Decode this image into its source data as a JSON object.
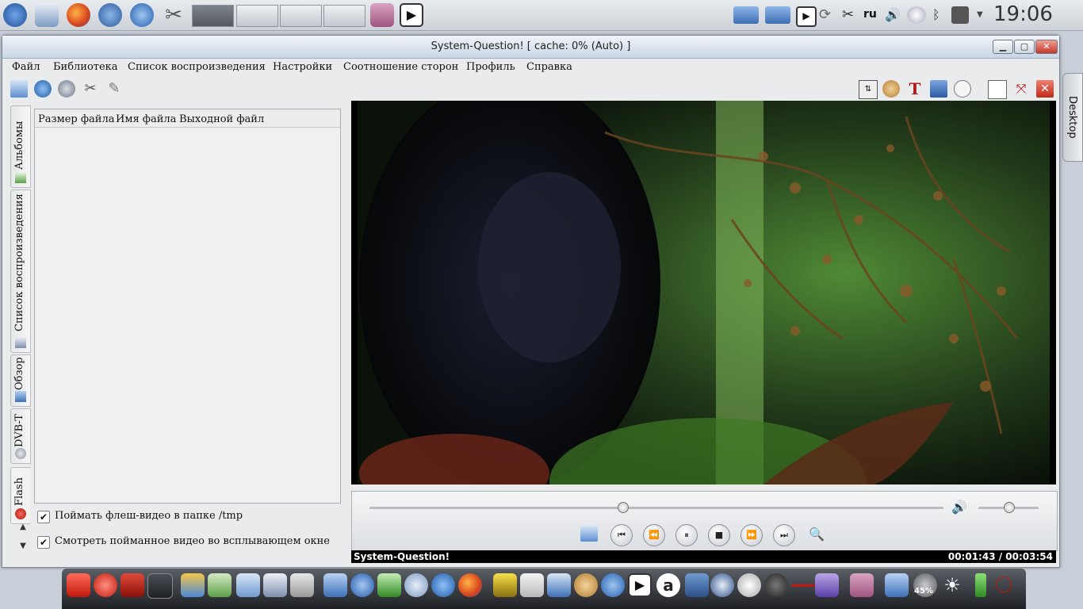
{
  "topbar": {
    "language": "ru",
    "clock": "19:06",
    "launchers": [
      "kde-menu-icon",
      "files-icon",
      "firefox-icon",
      "thunderbird-icon",
      "browser-icon",
      "settings-tools-icon"
    ],
    "taskbar_tabs": 4
  },
  "window": {
    "title": "System-Question! [ cache: 0% (Auto) ]",
    "controls": [
      "minimize",
      "maximize",
      "close"
    ]
  },
  "menu": [
    "Файл",
    "Библиотека",
    "Список воспроизведения",
    "Настройки",
    "Соотношение сторон",
    "Профиль",
    "Справка"
  ],
  "side_tabs": [
    {
      "label": "Альбомы"
    },
    {
      "label": "Список воспроизведения"
    },
    {
      "label": "Обзор"
    },
    {
      "label": "DVB-T"
    },
    {
      "label": "Flash"
    }
  ],
  "flash_panel": {
    "columns": [
      "Размер файла",
      "Имя файла",
      "Выходной файл"
    ],
    "options": [
      {
        "label": "Поймать флеш-видео в папке /tmp",
        "checked": true
      },
      {
        "label": "Смотреть пойманное видео во всплывающем окне",
        "checked": true
      }
    ]
  },
  "player": {
    "status_title": "System-Question!",
    "time": "00:01:43 / 00:03:54",
    "progress_fraction": 0.44,
    "volume_fraction": 0.5
  },
  "desktop_tab": "Desktop",
  "dock": {
    "battery": "45%"
  },
  "colors": {
    "accent": "#4a7fc1",
    "close_red": "#c6382a",
    "video_green": "#3d7a2a"
  }
}
